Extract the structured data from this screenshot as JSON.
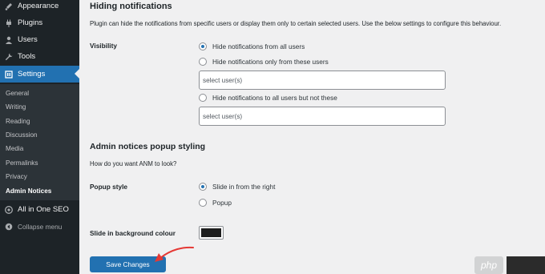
{
  "sidebar": {
    "items": [
      {
        "label": "Appearance",
        "icon": "paintbrush-icon"
      },
      {
        "label": "Plugins",
        "icon": "plugin-icon"
      },
      {
        "label": "Users",
        "icon": "users-icon"
      },
      {
        "label": "Tools",
        "icon": "wrench-icon"
      },
      {
        "label": "Settings",
        "icon": "settings-icon",
        "active": true
      }
    ],
    "submenu": [
      "General",
      "Writing",
      "Reading",
      "Discussion",
      "Media",
      "Permalinks",
      "Privacy",
      "Admin Notices"
    ],
    "current_sub": "Admin Notices",
    "extra": [
      {
        "label": "All in One SEO",
        "icon": "aioseo-icon"
      },
      {
        "label": "Collapse menu",
        "icon": "collapse-icon"
      }
    ]
  },
  "main": {
    "title": "Hiding notifications",
    "description": "Plugin can hide the notifications from specific users or display them only to certain selected users. Use the below settings to configure this behaviour.",
    "visibility": {
      "label": "Visibility",
      "options": [
        {
          "label": "Hide notifications from all users",
          "checked": true
        },
        {
          "label": "Hide notifications only from these users",
          "checked": false
        },
        {
          "label": "Hide notifications to all users but not these",
          "checked": false
        }
      ],
      "select_placeholder_1": "select user(s)",
      "select_placeholder_2": "select user(s)"
    },
    "popup_section": {
      "title": "Admin notices popup styling",
      "description": "How do you want ANM to look?"
    },
    "popup_style": {
      "label": "Popup style",
      "options": [
        {
          "label": "Slide in from the right",
          "checked": true
        },
        {
          "label": "Popup",
          "checked": false
        }
      ]
    },
    "bg_colour": {
      "label": "Slide in background colour",
      "value": "#1d1d1d"
    },
    "save_label": "Save Changes"
  },
  "watermark": {
    "text": "php"
  },
  "colors": {
    "sidebar_bg": "#1d2327",
    "accent": "#2271b1",
    "arrow": "#e53935"
  }
}
